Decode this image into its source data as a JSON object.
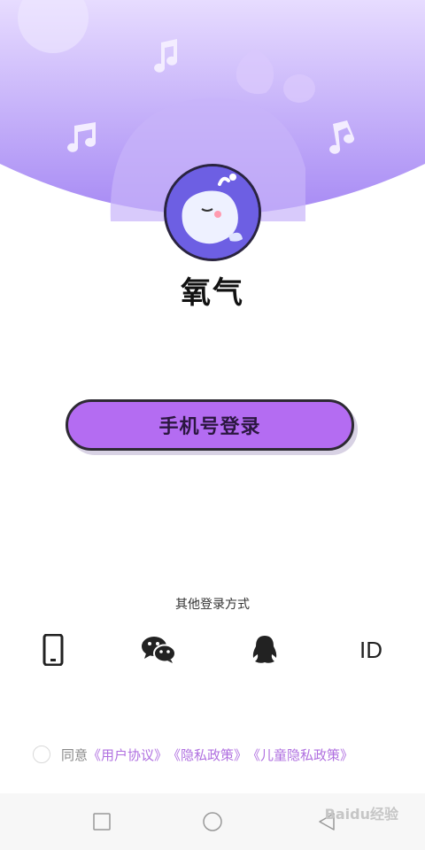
{
  "app": {
    "name": "氧气"
  },
  "login": {
    "phone_button_label": "手机号登录"
  },
  "other_login": {
    "title": "其他登录方式",
    "methods": [
      {
        "name": "phone",
        "icon": "phone-icon"
      },
      {
        "name": "wechat",
        "icon": "wechat-icon"
      },
      {
        "name": "qq",
        "icon": "qq-icon"
      },
      {
        "name": "id",
        "icon": "id-icon",
        "label": "ID"
      }
    ]
  },
  "agreement": {
    "prefix": "同意",
    "user_agreement": "《用户协议》",
    "privacy_policy": "《隐私政策》",
    "children_privacy": "《儿童隐私政策》"
  },
  "navbar": {
    "buttons": [
      "recent-apps-icon",
      "home-icon",
      "back-icon"
    ]
  },
  "watermark": {
    "text": "Baidu经验"
  },
  "colors": {
    "header": "#b89af8",
    "button": "#b46cf2",
    "link": "#b070e0"
  }
}
